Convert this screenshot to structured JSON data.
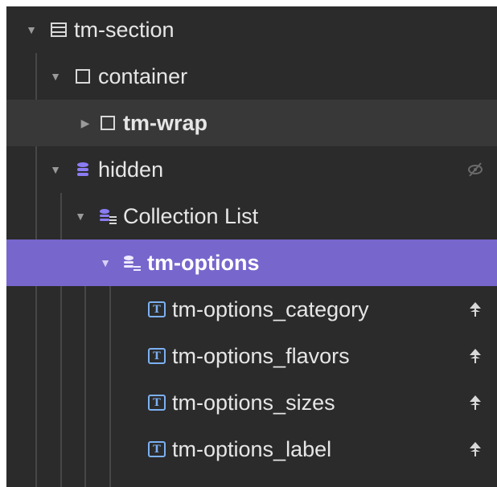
{
  "navigator": {
    "items": [
      {
        "label": "tm-section",
        "icon": "section-icon",
        "expanded": true
      },
      {
        "label": "container",
        "icon": "box-icon",
        "expanded": true
      },
      {
        "label": "tm-wrap",
        "icon": "box-icon",
        "expanded": false
      },
      {
        "label": "hidden",
        "icon": "cms-database-icon",
        "expanded": true,
        "visibility": "hidden"
      },
      {
        "label": "Collection List",
        "icon": "collection-list-icon",
        "expanded": true
      },
      {
        "label": "tm-options",
        "icon": "collection-item-icon",
        "expanded": true,
        "selected": true
      },
      {
        "label": "tm-options_category",
        "icon": "text-icon",
        "status": "cms-bound-icon"
      },
      {
        "label": "tm-options_flavors",
        "icon": "text-icon",
        "status": "cms-bound-icon"
      },
      {
        "label": "tm-options_sizes",
        "icon": "text-icon",
        "status": "cms-bound-icon"
      },
      {
        "label": "tm-options_label",
        "icon": "text-icon",
        "status": "cms-bound-icon"
      }
    ]
  },
  "colors": {
    "panel_bg": "#2b2b2b",
    "selected_bg": "#7766cc",
    "highlight_bg": "#383838",
    "cms_icon": "#8b7cf5",
    "text_icon": "#7cb0f2"
  }
}
